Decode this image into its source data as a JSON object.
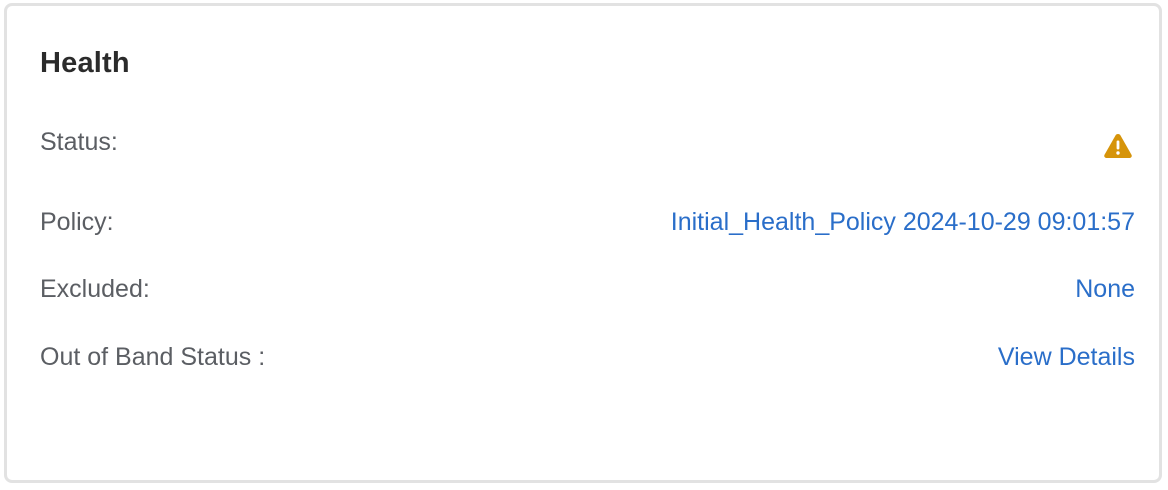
{
  "card": {
    "title": "Health",
    "rows": [
      {
        "label": "Status:",
        "icon": "warning-icon",
        "icon_color": "#d6940a"
      },
      {
        "label": "Policy:",
        "value": "Initial_Health_Policy 2024-10-29 09:01:57"
      },
      {
        "label": "Excluded:",
        "value": "None"
      },
      {
        "label": "Out of Band Status :",
        "value": "View Details"
      }
    ]
  },
  "colors": {
    "link": "#2a6ec9",
    "label": "#5b5e63",
    "title": "#2b2b2b",
    "warning": "#d6940a"
  }
}
